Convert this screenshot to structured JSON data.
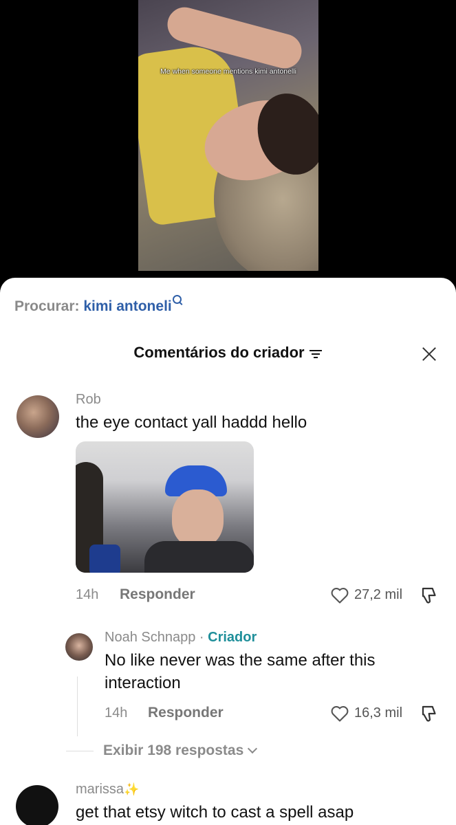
{
  "video": {
    "caption": "Me when someone mentions kimi antonelli"
  },
  "search": {
    "label": "Procurar:",
    "term": "kimi antoneli"
  },
  "panel": {
    "title": "Comentários do criador"
  },
  "comments": [
    {
      "username": "Rob",
      "text": "the eye contact yall haddd hello",
      "time": "14h",
      "reply_label": "Responder",
      "likes": "27,2 mil"
    },
    {
      "username": "Noah Schnapp",
      "separator": "·",
      "badge": "Criador",
      "text": "No like never was the same after this interaction",
      "time": "14h",
      "reply_label": "Responder",
      "likes": "16,3 mil"
    },
    {
      "username": "marissa",
      "text": "get that etsy witch to cast a spell asap"
    }
  ],
  "view_replies": "Exibir 198 respostas",
  "icons": {
    "search": "search-icon",
    "filter": "filter-icon",
    "close": "close-icon",
    "like": "heart-icon",
    "dislike": "dislike-icon",
    "sparkle": "sparkle-icon"
  }
}
